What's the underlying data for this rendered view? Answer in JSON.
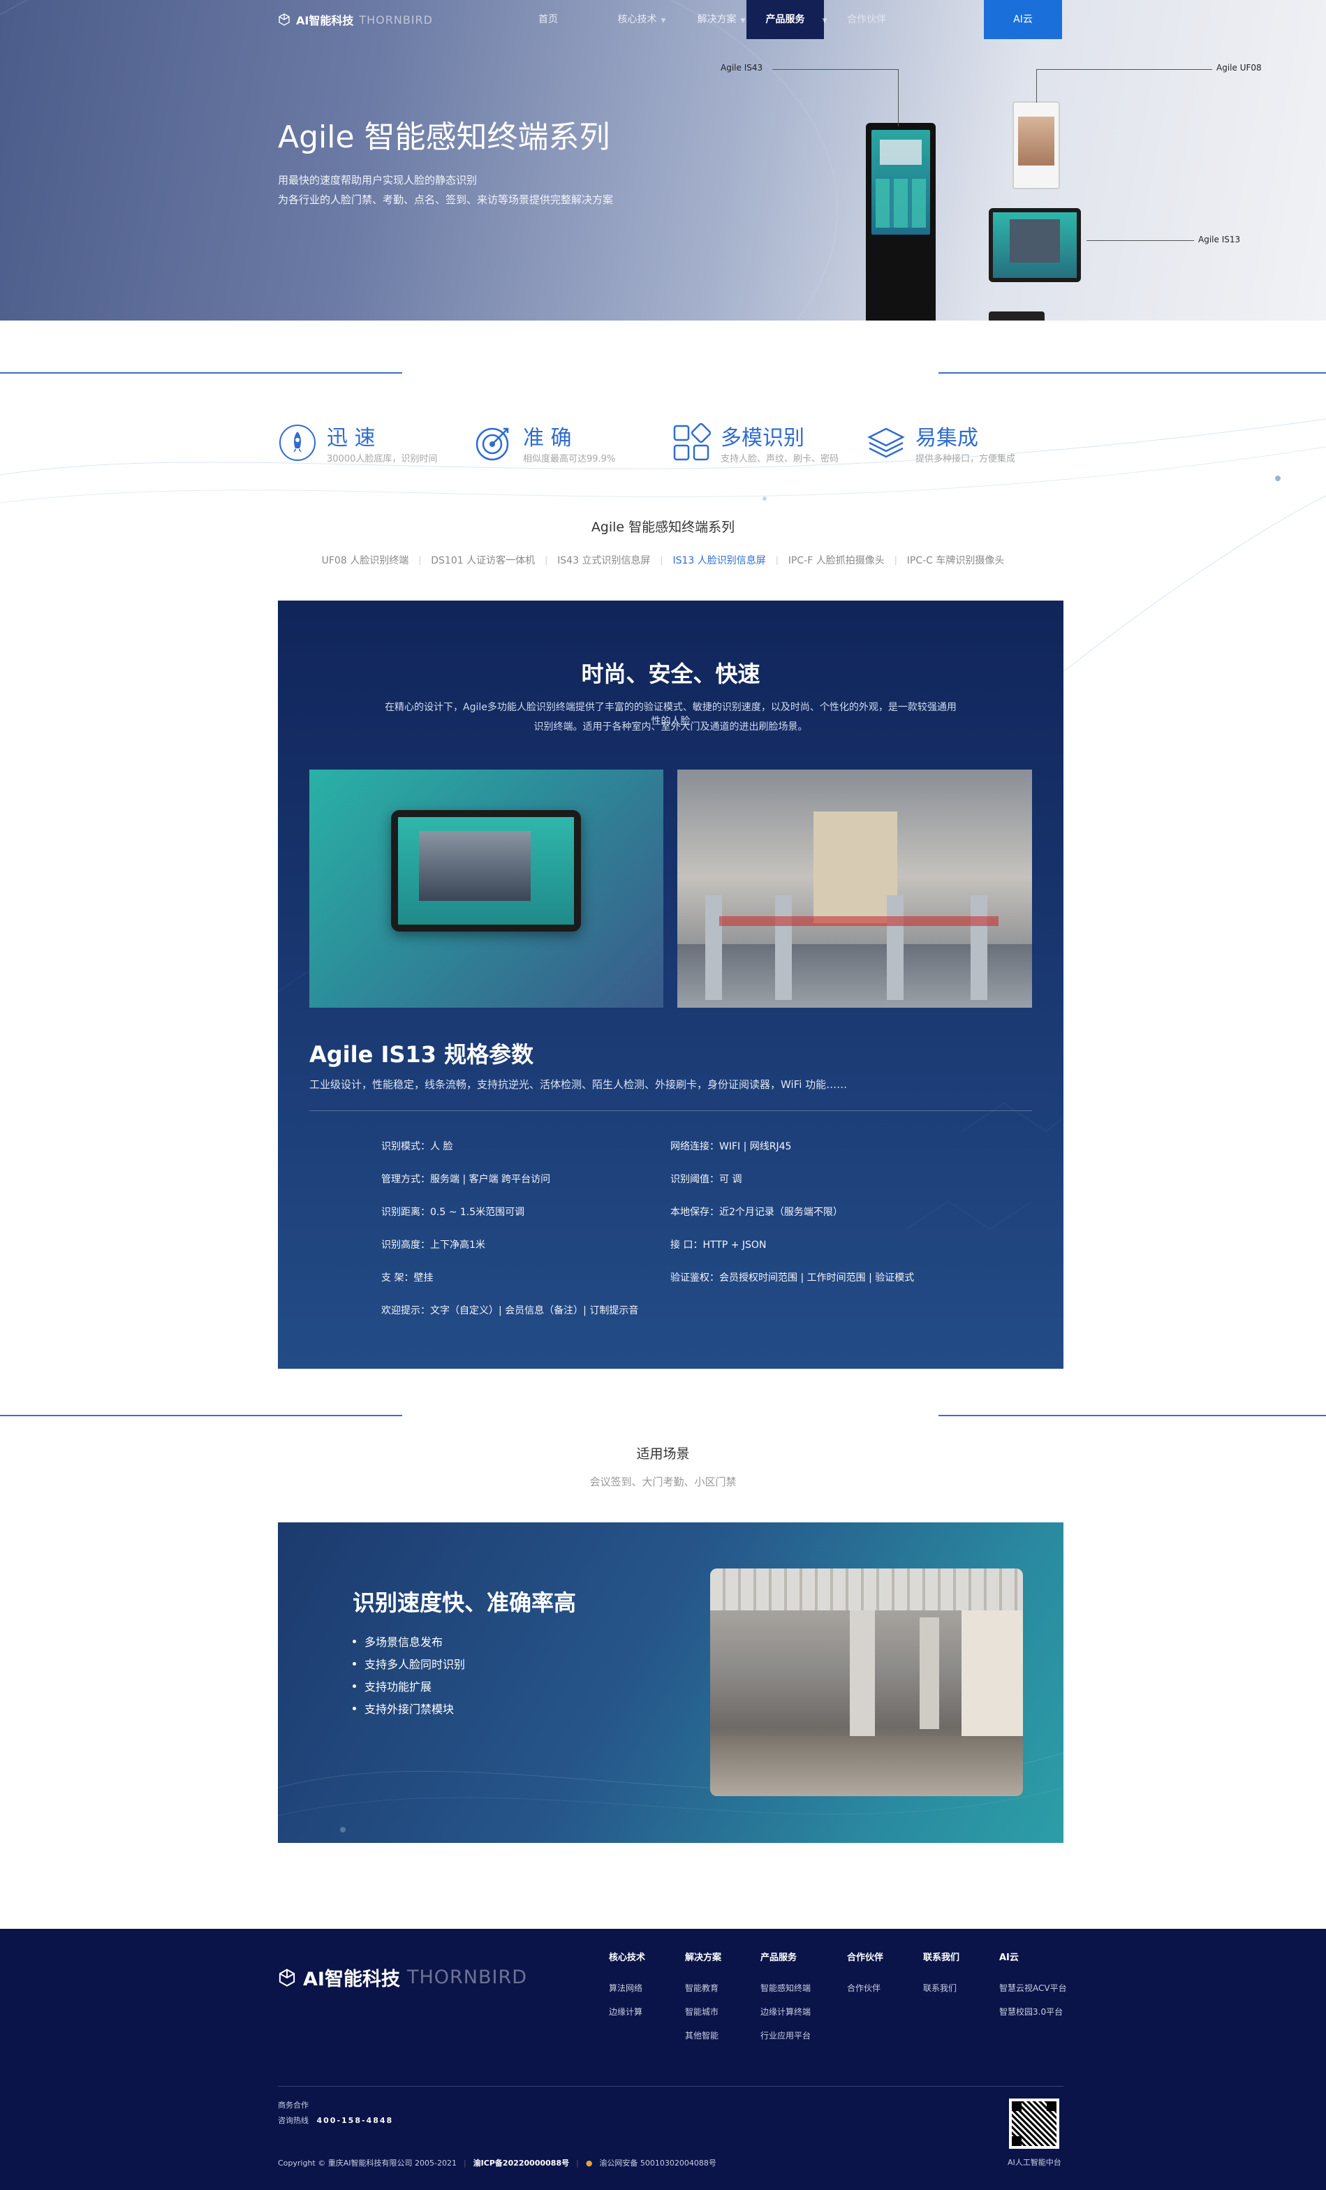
{
  "nav": {
    "brand": "AI智能科技",
    "brand_sub": "THORNBIRD",
    "items": [
      "首页",
      "核心技术",
      "解决方案",
      "产品服务",
      "合作伙伴"
    ],
    "active": "产品服务",
    "ai_button": "AI云"
  },
  "hero": {
    "title": "Agile 智能感知终端系列",
    "line1": "用最快的速度帮助用户实现人脸的静态识别",
    "line2": "为各行业的人脸门禁、考勤、点名、签到、来访等场景提供完整解决方案",
    "devices": {
      "is43": "Agile IS43",
      "uf08": "Agile  UF08",
      "is13": "Agile IS13"
    }
  },
  "features": [
    {
      "title": "迅 速",
      "sub": "30000人脸底库，识别时间",
      "icon": "rocket-icon"
    },
    {
      "title": "准 确",
      "sub": "相似度最高可达99.9%",
      "icon": "target-icon"
    },
    {
      "title": "多模识别",
      "sub": "支持人脸、声纹、刷卡、密码",
      "icon": "grid-icon"
    },
    {
      "title": "易集成",
      "sub": "提供多种接口，方便集成",
      "icon": "layers-icon"
    }
  ],
  "series": {
    "title": "Agile 智能感知终端系列",
    "tabs": [
      "UF08 人脸识别终端",
      "DS101 人证访客一体机",
      "IS43 立式识别信息屏",
      "IS13 人脸识别信息屏",
      "IPC-F 人脸抓拍摄像头",
      "IPC-C 车牌识别摄像头"
    ],
    "active": "IS13 人脸识别信息屏"
  },
  "spec": {
    "title": "时尚、安全、快速",
    "desc1": "在精心的设计下，Agile多功能人脸识别终端提供了丰富的的验证模式、敏捷的识别速度，以及时尚、个性化的外观，是一款较强通用性的人脸",
    "desc2": "识别终端。适用于各种室内、室外大门及通道的进出刷脸场景。",
    "model_title": "Agile IS13  规格参数",
    "model_desc": "工业级设计，性能稳定，线条流畅，支持抗逆光、活体检测、陌生人检测、外接刷卡，身份证阅读器，WiFi 功能……",
    "params_left": [
      "识别模式：人 脸",
      "管理方式：服务端 | 客户端 跨平台访问",
      "识别距离：0.5 ~ 1.5米范围可调",
      "识别高度：上下净高1米",
      "支 架：壁挂",
      "欢迎提示：文字（自定义）| 会员信息（备注）| 订制提示音"
    ],
    "params_right": [
      "网络连接：WIFI | 网线RJ45",
      "识别阈值：可 调",
      "本地保存：近2个月记录（服务端不限）",
      "接 口：HTTP + JSON",
      "验证鉴权：会员授权时间范围 | 工作时间范围 | 验证模式"
    ]
  },
  "scenes": {
    "title": "适用场景",
    "sub": "会议签到、大门考勤、小区门禁",
    "panel_title": "识别速度快、准确率高",
    "items": [
      "多场景信息发布",
      "支持多人脸同时识别",
      "支持功能扩展",
      "支持外接门禁模块"
    ]
  },
  "footer": {
    "brand": "AI智能科技",
    "brand_sub": "THORNBIRD",
    "cols": [
      {
        "title": "核心技术",
        "items": [
          "算法网络",
          "边缘计算"
        ]
      },
      {
        "title": "解决方案",
        "items": [
          "智能教育",
          "智能城市",
          "其他智能"
        ]
      },
      {
        "title": "产品服务",
        "items": [
          "智能感知终端",
          "边缘计算终端",
          "行业应用平台"
        ]
      },
      {
        "title": "合作伙伴",
        "items": [
          "合作伙伴"
        ]
      },
      {
        "title": "联系我们",
        "items": [
          "联系我们"
        ]
      },
      {
        "title": "AI云",
        "items": [
          "智慧云视ACV平台",
          "智慧校园3.0平台"
        ]
      }
    ],
    "biz": "商务合作",
    "hotline_label": "咨询热线",
    "hotline": "400-158-4848",
    "copyright": "Copyright © 重庆AI智能科技有限公司 2005-2021",
    "icp": "渝ICP备20220000088号",
    "police": "渝公网安备 50010302004088号",
    "qr_caption": "AI人工智能中台"
  },
  "colors": {
    "accent": "#2f6cd0",
    "nav_active": "#122056",
    "ai_button": "#1a6fdb",
    "footer_bg": "#0a1448"
  }
}
